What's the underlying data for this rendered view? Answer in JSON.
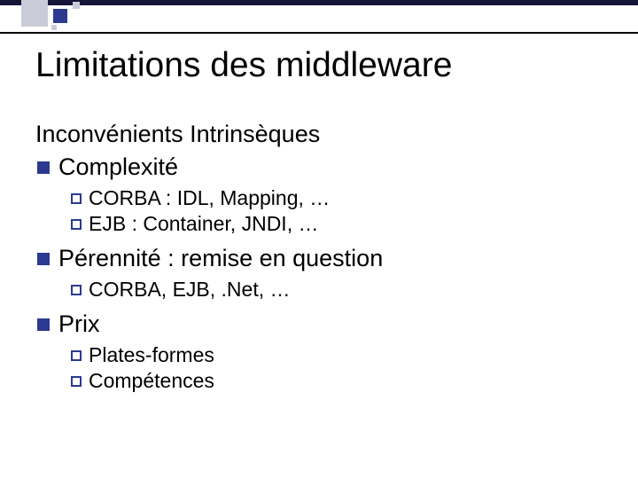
{
  "title": "Limitations des middleware",
  "subhead": "Inconvénients Intrinsèques",
  "items": [
    {
      "label": "Complexité",
      "sub": [
        "CORBA : IDL, Mapping, …",
        "EJB : Container, JNDI, …"
      ]
    },
    {
      "label": "Pérennité : remise en question",
      "sub": [
        "CORBA, EJB, .Net, …"
      ]
    },
    {
      "label": "Prix",
      "sub": [
        "Plates-formes",
        "Compétences"
      ]
    }
  ]
}
